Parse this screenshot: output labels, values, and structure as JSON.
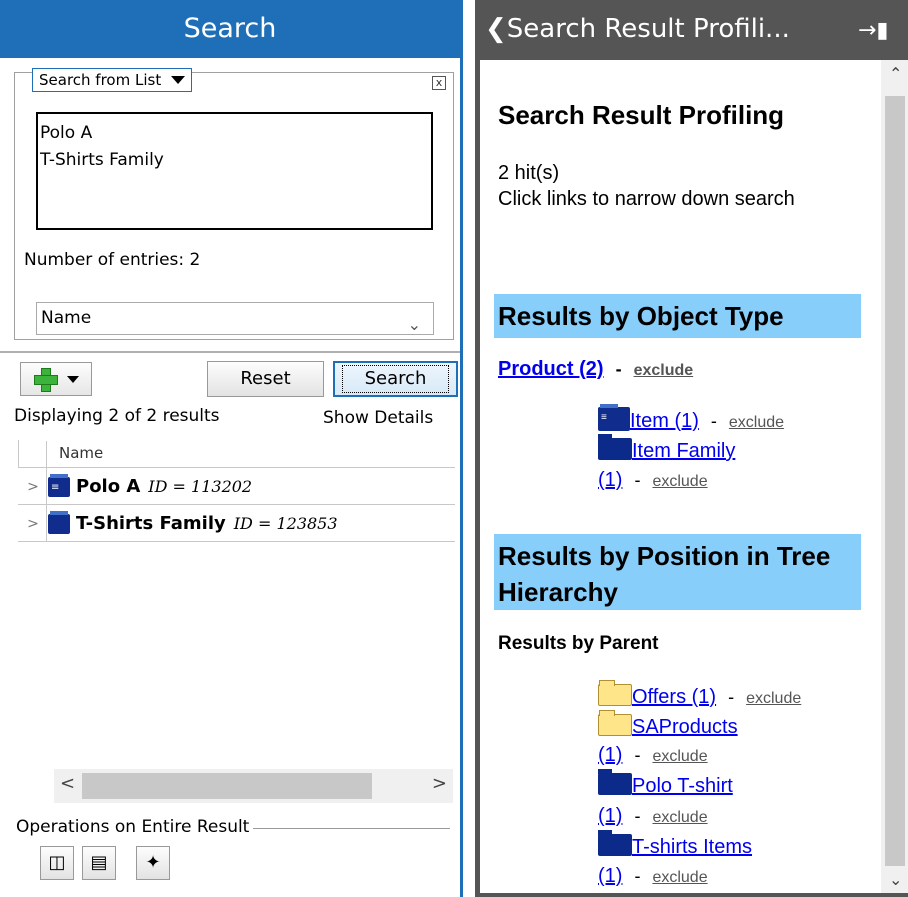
{
  "left": {
    "title": "Search",
    "search_mode": "Search from List",
    "close_glyph": "x",
    "entries": [
      "Polo A",
      "T-Shirts Family"
    ],
    "entry_count_label": "Number of entries: 2",
    "attribute_select": "Name",
    "add_icon": "green-plus-icon",
    "reset_label": "Reset",
    "search_label": "Search",
    "displaying": "Displaying 2 of 2 results",
    "show_details": "Show Details",
    "grid": {
      "column_header": "Name",
      "rows": [
        {
          "name": "Polo A",
          "id": "ID = 113202",
          "icon": "item-cube-icon"
        },
        {
          "name": "T-Shirts Family",
          "id": "ID = 123853",
          "icon": "family-cube-icon"
        }
      ]
    },
    "operations_label": "Operations on Entire Result",
    "operations_icons": [
      "database-icon",
      "export-icon",
      "wand-icon"
    ]
  },
  "right": {
    "title": "Search Result Profili...",
    "heading": "Search Result Profiling",
    "hits": "2 hit(s)",
    "hint": "Click links to narrow down search",
    "section_object_type": "Results by Object Type",
    "product_link": "Product (2)",
    "item_link": "Item (1)",
    "item_family_link_a": "Item Family",
    "item_family_link_b": "(1)",
    "section_position": "Results by Position in Tree Hierarchy",
    "by_parent": "Results by Parent",
    "offers_link": "Offers (1)",
    "saproducts_a": "SAProducts",
    "saproducts_b": "(1)",
    "polo_a": "Polo T-shirt",
    "polo_b": "(1)",
    "tshirts_a": "T-shirts Items",
    "tshirts_b": "(1)",
    "exclude": "exclude",
    "dash": "-"
  },
  "colors": {
    "accent": "#1f6fb8",
    "band": "#87cefa",
    "link": "#0000ee",
    "panel_dark": "#555555"
  }
}
